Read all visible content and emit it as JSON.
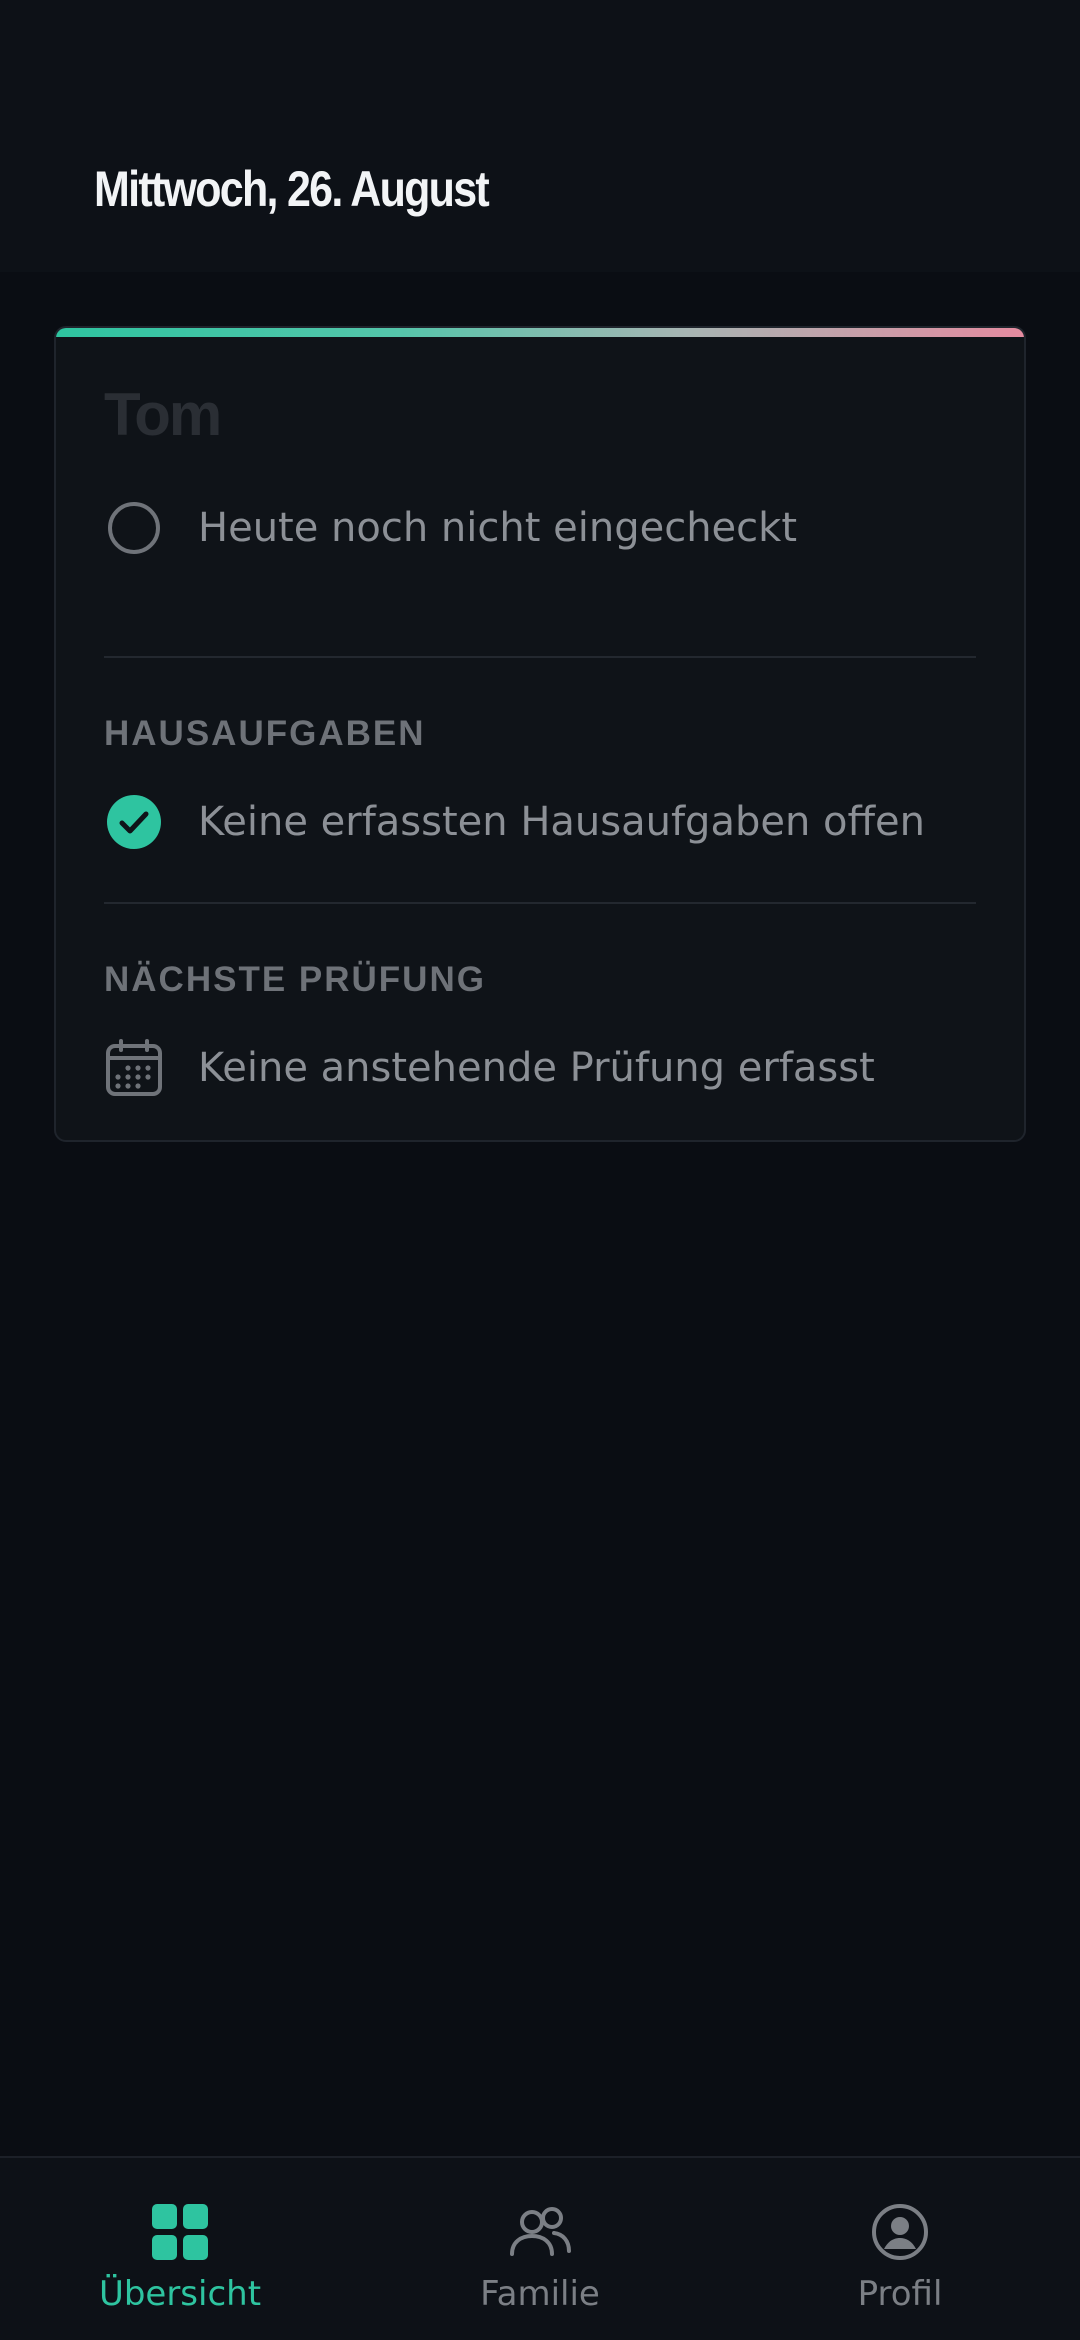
{
  "header": {
    "title": "Mittwoch, 26. August"
  },
  "card": {
    "name": "Tom",
    "checkin_text": "Heute noch nicht eingecheckt",
    "homework": {
      "label": "HAUSAUFGABEN",
      "text": "Keine erfassten Hausaufgaben offen"
    },
    "exam": {
      "label": "NÄCHSTE PRÜFUNG",
      "text": "Keine anstehende Prüfung erfasst"
    }
  },
  "nav": {
    "items": [
      {
        "label": "Übersicht",
        "icon": "grid-icon",
        "active": true
      },
      {
        "label": "Familie",
        "icon": "people-icon",
        "active": false
      },
      {
        "label": "Profil",
        "icon": "profile-icon",
        "active": false
      }
    ]
  },
  "colors": {
    "accent": "#2ec4a0",
    "accent_end": "#e58ba0",
    "background": "#0a0d13",
    "card": "#0f1318"
  }
}
